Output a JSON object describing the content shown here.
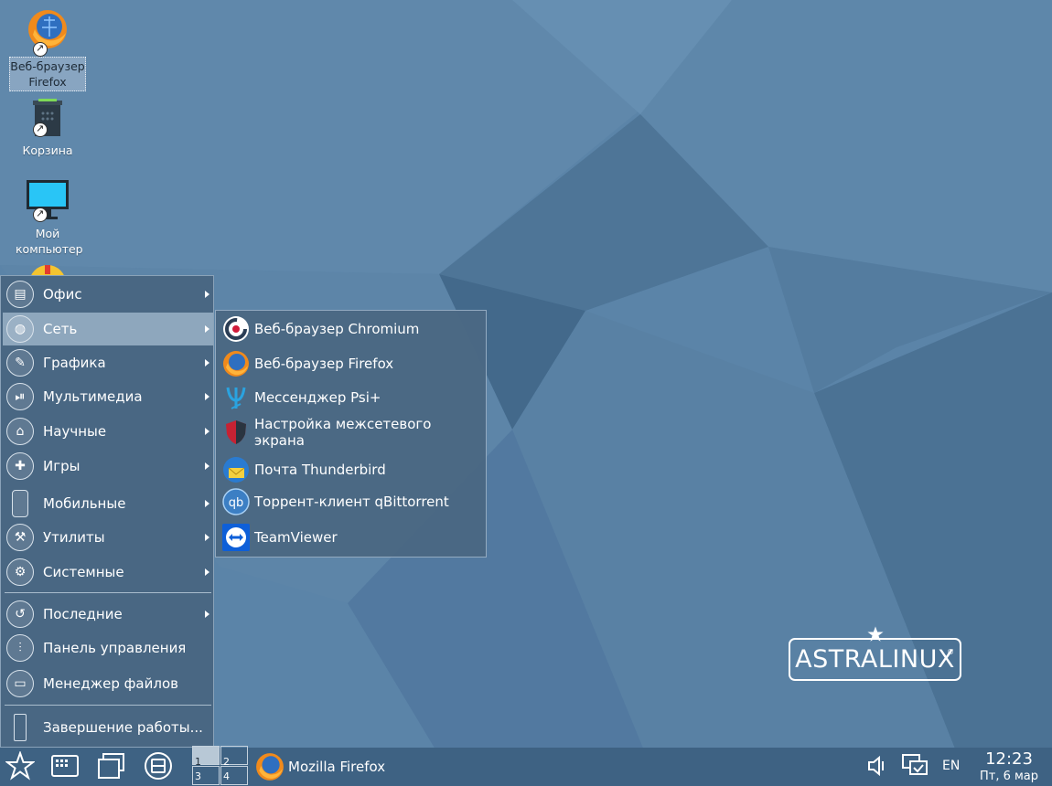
{
  "desktop": {
    "icons": [
      {
        "label": "Веб-браузер Firefox",
        "selected": true
      },
      {
        "label": "Корзина"
      },
      {
        "label": "Мой компьютер"
      }
    ]
  },
  "start_menu": {
    "items": [
      {
        "label": "Офис",
        "icon": "office-icon",
        "has_submenu": true
      },
      {
        "label": "Сеть",
        "icon": "network-globe-icon",
        "has_submenu": true,
        "active": true
      },
      {
        "label": "Графика",
        "icon": "graphics-brush-icon",
        "has_submenu": true
      },
      {
        "label": "Мультимедиа",
        "icon": "multimedia-icon",
        "has_submenu": true
      },
      {
        "label": "Научные",
        "icon": "science-icon",
        "has_submenu": true
      },
      {
        "label": "Игры",
        "icon": "gamepad-icon",
        "has_submenu": true
      },
      {
        "label": "Мобильные",
        "icon": "mobile-phone-icon",
        "has_submenu": true
      },
      {
        "label": "Утилиты",
        "icon": "wrench-icon",
        "has_submenu": true
      },
      {
        "label": "Системные",
        "icon": "gear-icon",
        "has_submenu": true
      },
      {
        "label": "Последние",
        "icon": "history-icon",
        "has_submenu": true
      },
      {
        "label": "Панель управления",
        "icon": "control-panel-icon",
        "has_submenu": false
      },
      {
        "label": "Менеджер файлов",
        "icon": "file-manager-icon",
        "has_submenu": false
      },
      {
        "label": "Завершение работы...",
        "icon": "logout-door-icon",
        "has_submenu": false
      }
    ]
  },
  "network_submenu": {
    "items": [
      {
        "label": "Веб-браузер Chromium",
        "icon": "chromium-icon"
      },
      {
        "label": "Веб-браузер Firefox",
        "icon": "firefox-icon"
      },
      {
        "label": "Мессенджер Psi+",
        "icon": "psi-plus-icon"
      },
      {
        "label": "Настройка межсетевого экрана",
        "icon": "firewall-shield-icon"
      },
      {
        "label": "Почта Thunderbird",
        "icon": "thunderbird-icon"
      },
      {
        "label": "Торрент-клиент qBittorrent",
        "icon": "qbittorrent-icon"
      },
      {
        "label": "TeamViewer",
        "icon": "teamviewer-icon"
      }
    ]
  },
  "logo": {
    "text": "ASTRALINUX",
    "mark": "®"
  },
  "taskbar": {
    "pager": [
      "1",
      "2",
      "3",
      "4"
    ],
    "active_task": "Mozilla Firefox",
    "language": "EN",
    "time": "12:23",
    "date": "Пт,  6 мар"
  },
  "colors": {
    "wallpaper": "#5a83a7",
    "taskbar": "#3e6283",
    "menu_bg": "#486682",
    "menu_active": "#8ea7bd"
  }
}
